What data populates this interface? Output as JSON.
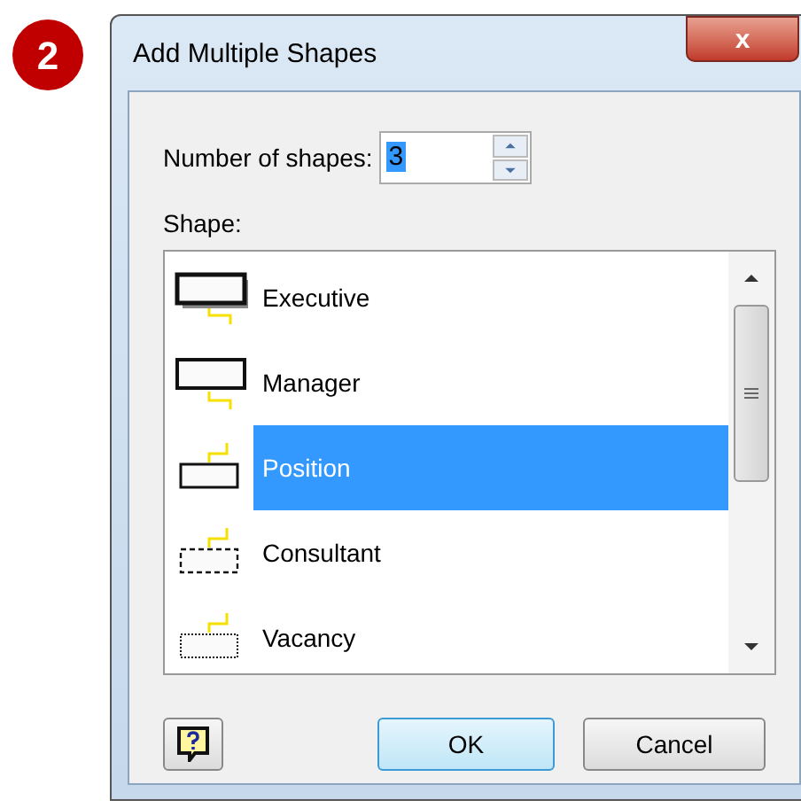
{
  "step_badge": "2",
  "window": {
    "title": "Add Multiple Shapes",
    "close": "x"
  },
  "number_field": {
    "label": "Number of shapes:",
    "value": "3"
  },
  "shape_list": {
    "label": "Shape:",
    "items": [
      {
        "label": "Executive",
        "kind": "executive",
        "selected": false
      },
      {
        "label": "Manager",
        "kind": "manager",
        "selected": false
      },
      {
        "label": "Position",
        "kind": "position",
        "selected": true
      },
      {
        "label": "Consultant",
        "kind": "consultant",
        "selected": false
      },
      {
        "label": "Vacancy",
        "kind": "vacancy",
        "selected": false
      }
    ]
  },
  "buttons": [
    {
      "label": "OK",
      "default": true
    },
    {
      "label": "Cancel",
      "default": false
    }
  ]
}
